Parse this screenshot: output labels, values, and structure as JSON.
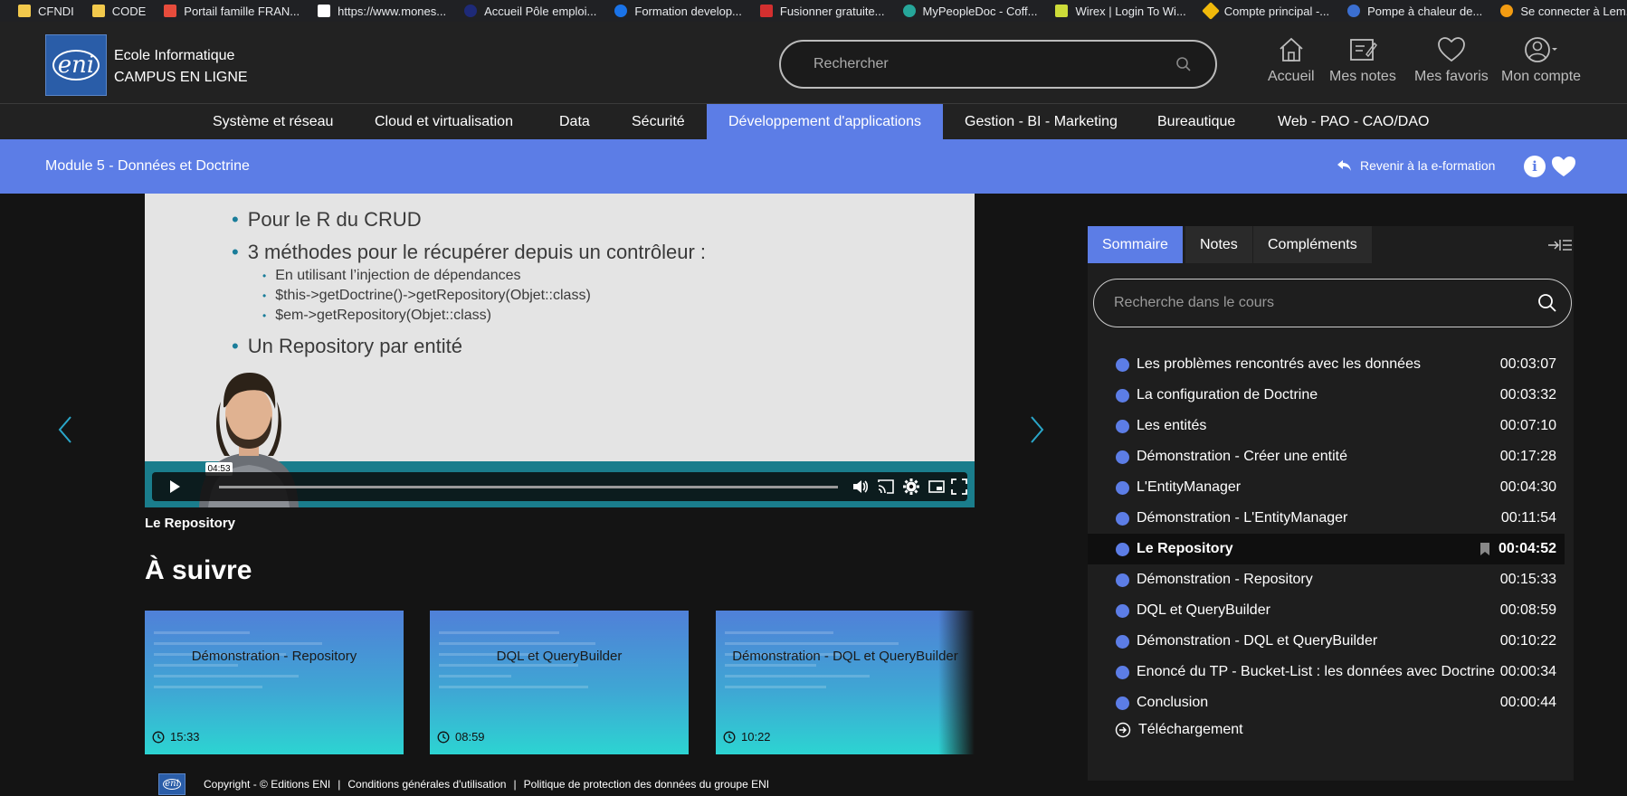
{
  "bookmarks": [
    {
      "label": "CFNDI",
      "color": "#f2c94c"
    },
    {
      "label": "CODE",
      "color": "#f2c94c"
    },
    {
      "label": "Portail famille FRAN...",
      "color": "#e74c3c"
    },
    {
      "label": "https://www.mones...",
      "color": "#ffffff"
    },
    {
      "label": "Accueil Pôle emploi...",
      "color": "#1e2a78"
    },
    {
      "label": "Formation develop...",
      "color": "#1a73e8"
    },
    {
      "label": "Fusionner gratuite...",
      "color": "#d32f2f"
    },
    {
      "label": "MyPeopleDoc - Coff...",
      "color": "#26a69a"
    },
    {
      "label": "Wirex | Login To Wi...",
      "color": "#cddc39"
    },
    {
      "label": "Compte principal -...",
      "color": "#f0b90b"
    },
    {
      "label": "Pompe à chaleur de...",
      "color": "#3b6fd1"
    },
    {
      "label": "Se connecter à Lem...",
      "color": "#f39c12"
    }
  ],
  "header": {
    "logo_text": "eni",
    "school_line1": "Ecole Informatique",
    "school_line2": "CAMPUS EN LIGNE",
    "search_placeholder": "Rechercher",
    "nav": {
      "home": "Accueil",
      "notes": "Mes notes",
      "favorites": "Mes favoris",
      "account": "Mon compte"
    }
  },
  "categories": [
    "Système et réseau",
    "Cloud et virtualisation",
    "Data",
    "Sécurité",
    "Développement d'applications",
    "Gestion - BI - Marketing",
    "Bureautique",
    "Web - PAO - CAO/DAO"
  ],
  "module": {
    "title": "Module 5 - Données et Doctrine",
    "back_label": "Revenir à la e-formation",
    "info_label": "i"
  },
  "video": {
    "slide": {
      "bullet1": "Pour le R du CRUD",
      "bullet2": "3 méthodes pour le récupérer depuis un contrôleur :",
      "sub1": "En utilisant l’injection de dépendances",
      "sub2": "$this->getDoctrine()->getRepository(Objet::class)",
      "sub3": "$em->getRepository(Objet::class)",
      "bullet3": "Un Repository par entité"
    },
    "hover_time": "04:53",
    "title": "Le Repository"
  },
  "up_next": {
    "heading": "À suivre",
    "cards": [
      {
        "title": "Démonstration - Repository",
        "duration": "15:33"
      },
      {
        "title": "DQL et QueryBuilder",
        "duration": "08:59"
      },
      {
        "title": "Démonstration - DQL et QueryBuilder",
        "duration": "10:22"
      }
    ]
  },
  "footer": {
    "copyright": "Copyright - © Editions ENI",
    "cgu": "Conditions générales d'utilisation",
    "privacy": "Politique de protection des données du groupe ENI"
  },
  "sidebar": {
    "tabs": [
      "Sommaire",
      "Notes",
      "Compléments"
    ],
    "search_placeholder": "Recherche dans le cours",
    "lessons": [
      {
        "name": "Les problèmes rencontrés avec les données",
        "duration": "00:03:07"
      },
      {
        "name": "La configuration de Doctrine",
        "duration": "00:03:32"
      },
      {
        "name": "Les entités",
        "duration": "00:07:10"
      },
      {
        "name": "Démonstration - Créer une entité",
        "duration": "00:17:28"
      },
      {
        "name": "L'EntityManager",
        "duration": "00:04:30"
      },
      {
        "name": "Démonstration - L'EntityManager",
        "duration": "00:11:54"
      },
      {
        "name": "Le Repository",
        "duration": "00:04:52",
        "current": true
      },
      {
        "name": "Démonstration - Repository",
        "duration": "00:15:33"
      },
      {
        "name": "DQL et QueryBuilder",
        "duration": "00:08:59"
      },
      {
        "name": "Démonstration - DQL et QueryBuilder",
        "duration": "00:10:22"
      },
      {
        "name": "Enoncé du TP - Bucket-List : les données avec Doctrine",
        "duration": "00:00:34"
      },
      {
        "name": "Conclusion",
        "duration": "00:00:44"
      }
    ],
    "download": "Téléchargement"
  },
  "colors": {
    "accent": "#5c7de6",
    "teal": "#1a7d8c",
    "arrow": "#2aa6c9"
  }
}
